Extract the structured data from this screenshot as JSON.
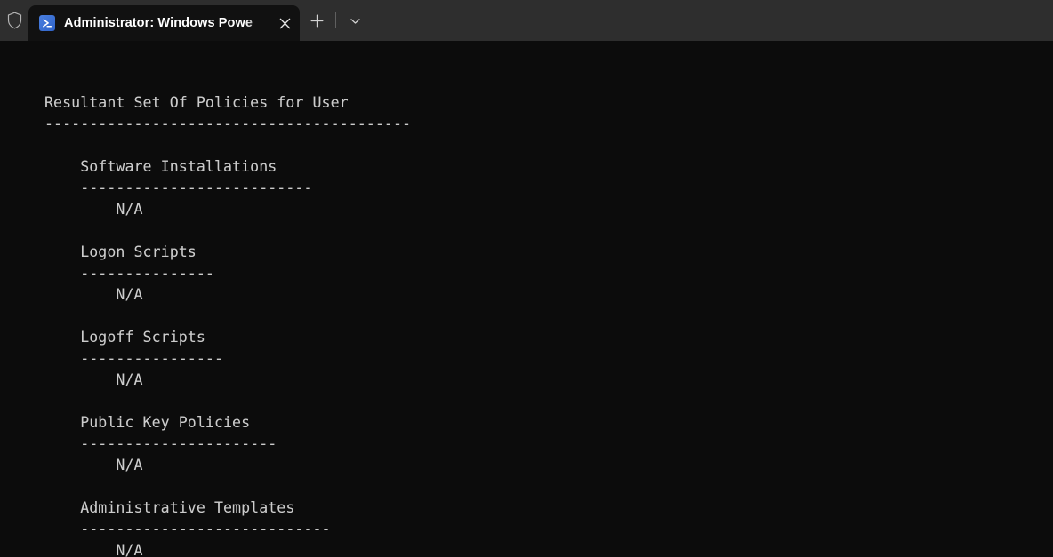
{
  "window": {
    "titlebar_bg": "#2e2e2e",
    "terminal_bg": "#0c0c0c",
    "text_color": "#cccccc",
    "accent_color": "#3a6fd8"
  },
  "tabbar": {
    "admin_shield_icon": "shield-icon",
    "tabs": [
      {
        "icon": "powershell-icon",
        "title": "Administrator: Windows Powe",
        "close_label": "✕",
        "active": true
      }
    ],
    "new_tab_label": "+",
    "dropdown_label": "⌄"
  },
  "terminal": {
    "title": "Resultant Set Of Policies for User",
    "title_rule": "-----------------------------------------",
    "sections": [
      {
        "heading": "Software Installations",
        "rule": "--------------------------",
        "value": "N/A"
      },
      {
        "heading": "Logon Scripts",
        "rule": "---------------",
        "value": "N/A"
      },
      {
        "heading": "Logoff Scripts",
        "rule": "----------------",
        "value": "N/A"
      },
      {
        "heading": "Public Key Policies",
        "rule": "----------------------",
        "value": "N/A"
      },
      {
        "heading": "Administrative Templates",
        "rule": "----------------------------",
        "value": "N/A"
      }
    ],
    "full_output": "Resultant Set Of Policies for User\n-----------------------------------------\n\n    Software Installations\n    --------------------------\n        N/A\n\n    Logon Scripts\n    ---------------\n        N/A\n\n    Logoff Scripts\n    ----------------\n        N/A\n\n    Public Key Policies\n    ----------------------\n        N/A\n\n    Administrative Templates\n    ----------------------------\n        N/A"
  }
}
